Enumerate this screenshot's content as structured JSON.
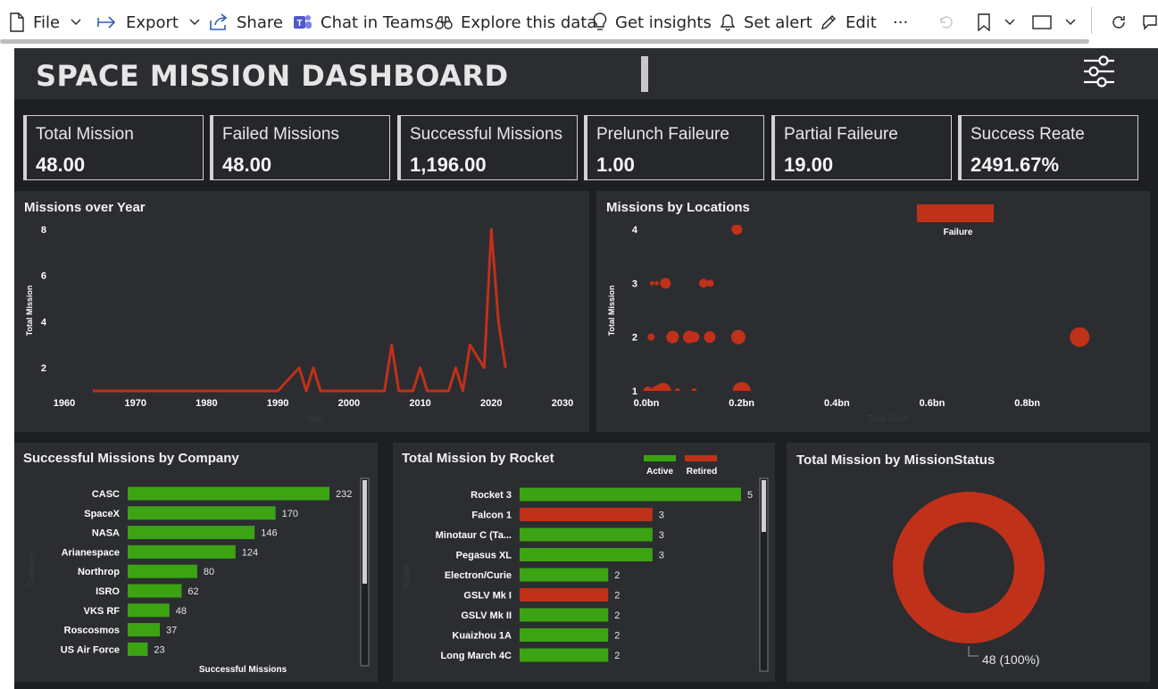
{
  "toolbar": {
    "file": "File",
    "export": "Export",
    "share": "Share",
    "chat": "Chat in Teams",
    "explore": "Explore this data",
    "insights": "Get insights",
    "alert": "Set alert",
    "edit": "Edit",
    "more": "···"
  },
  "dashboard": {
    "title": "SPACE MISSION DASHBOARD"
  },
  "kpis": [
    {
      "label": "Total Mission",
      "value": "48.00"
    },
    {
      "label": "Failed Missions",
      "value": "48.00"
    },
    {
      "label": "Successful Missions",
      "value": "1,196.00"
    },
    {
      "label": "Prelunch Faileure",
      "value": "1.00"
    },
    {
      "label": "Partial Faileure",
      "value": "19.00"
    },
    {
      "label": "Success Reate",
      "value": "2491.67%"
    }
  ],
  "colors": {
    "green": "#3ca313",
    "red": "#c0311a",
    "canvas": "#1e1f22",
    "panel": "#2b2d31"
  },
  "panels": {
    "year": "Missions over Year",
    "locations": "Missions by Locations",
    "company": "Successful Missions by Company",
    "rocket": "Total Mission by Rocket",
    "status": "Total Mission by MissionStatus"
  },
  "chart_data": [
    {
      "type": "line",
      "title": "Missions over Year",
      "xlabel": "Year",
      "ylabel": "Total Mission",
      "xlim": [
        1960,
        2030
      ],
      "ylim": [
        1,
        8
      ],
      "x_ticks": [
        "1960",
        "1970",
        "1980",
        "1990",
        "2000",
        "2010",
        "2020",
        "2030"
      ],
      "y_ticks": [
        "2",
        "4",
        "6",
        "8"
      ],
      "color": "#c0311a",
      "series": [
        {
          "x": [
            1964,
            1990,
            1993,
            1994,
            1995,
            1996,
            2005,
            2006,
            2007,
            2009,
            2010,
            2011,
            2014,
            2015,
            2016,
            2017,
            2018,
            2019,
            2020,
            2021,
            2022
          ],
          "y": [
            1,
            1,
            2,
            1,
            2,
            1,
            1,
            3,
            1,
            1,
            2,
            1,
            1,
            2,
            1,
            3,
            2.5,
            2,
            8,
            4,
            2
          ]
        }
      ]
    },
    {
      "type": "scatter",
      "title": "Missions by Locations",
      "xlabel": "Total Cost",
      "ylabel": "Total Mission",
      "xlim": [
        0,
        0.9
      ],
      "ylim": [
        1,
        4
      ],
      "x_ticks": [
        "0.0bn",
        "0.2bn",
        "0.4bn",
        "0.6bn",
        "0.8bn"
      ],
      "y_ticks": [
        "1",
        "2",
        "3",
        "4"
      ],
      "legend": [
        "Failure"
      ],
      "legend_position": "top-right",
      "color": "#c0311a",
      "points": [
        {
          "x": 0.19,
          "y": 4,
          "r": 6
        },
        {
          "x": 0.012,
          "y": 3,
          "r": 2.5
        },
        {
          "x": 0.022,
          "y": 3,
          "r": 2.5
        },
        {
          "x": 0.04,
          "y": 3,
          "r": 6
        },
        {
          "x": 0.12,
          "y": 3,
          "r": 5
        },
        {
          "x": 0.134,
          "y": 3,
          "r": 4
        },
        {
          "x": 0.01,
          "y": 2,
          "r": 4
        },
        {
          "x": 0.055,
          "y": 2,
          "r": 7
        },
        {
          "x": 0.09,
          "y": 2,
          "r": 7
        },
        {
          "x": 0.1,
          "y": 2,
          "r": 6
        },
        {
          "x": 0.133,
          "y": 2,
          "r": 6.5
        },
        {
          "x": 0.193,
          "y": 2,
          "r": 8
        },
        {
          "x": 0.91,
          "y": 2,
          "r": 11
        },
        {
          "x": 0.003,
          "y": 1,
          "r": 5
        },
        {
          "x": 0.022,
          "y": 1,
          "r": 6
        },
        {
          "x": 0.035,
          "y": 1,
          "r": 9
        },
        {
          "x": 0.065,
          "y": 1,
          "r": 3
        },
        {
          "x": 0.1,
          "y": 1,
          "r": 3
        },
        {
          "x": 0.2,
          "y": 1,
          "r": 10
        }
      ]
    },
    {
      "type": "bar",
      "orientation": "horizontal",
      "title": "Successful Missions by Company",
      "xlabel": "Successful Missions",
      "ylabel": "Company",
      "categories": [
        "CASC",
        "SpaceX",
        "NASA",
        "Arianespace",
        "Northrop",
        "ISRO",
        "VKS RF",
        "Roscosmos",
        "US Air Force"
      ],
      "values": [
        232,
        170,
        146,
        124,
        80,
        62,
        48,
        37,
        23
      ],
      "xlim": [
        0,
        232
      ],
      "color": "#3ca313"
    },
    {
      "type": "bar",
      "orientation": "horizontal",
      "title": "Total Mission by Rocket",
      "xlabel": "",
      "ylabel": "Rocket",
      "categories": [
        "Rocket 3",
        "Falcon 1",
        "Minotaur C (Ta...",
        "Pegasus XL",
        "Electron/Curie",
        "GSLV Mk I",
        "GSLV Mk II",
        "Kuaizhou 1A",
        "Long March 4C"
      ],
      "values": [
        5,
        3,
        3,
        3,
        2,
        2,
        2,
        2,
        2
      ],
      "status": [
        "Active",
        "Retired",
        "Active",
        "Active",
        "Active",
        "Retired",
        "Active",
        "Active",
        "Active"
      ],
      "legend": [
        "Active",
        "Retired"
      ],
      "legend_position": "top-right",
      "xlim": [
        0,
        5
      ]
    },
    {
      "type": "pie",
      "donut": true,
      "title": "Total Mission by MissionStatus",
      "values": [
        48
      ],
      "data_labels": [
        "48 (100%)"
      ],
      "color": "#c0311a"
    }
  ]
}
